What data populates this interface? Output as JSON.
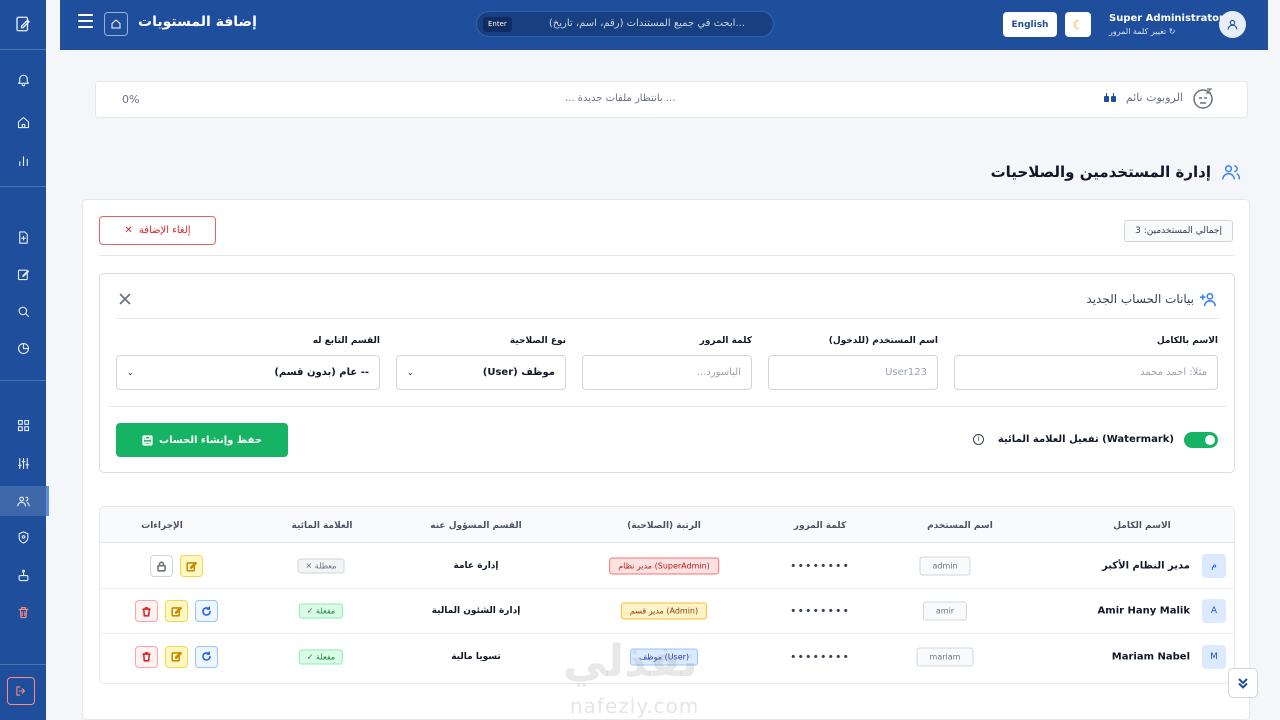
{
  "topbar": {
    "title": "إضافة المستويات",
    "search_placeholder": "ابحث في جميع المستندات (رقم، اسم، تاريخ)...",
    "search_hint": "Enter",
    "language_label": "English",
    "theme_icon": "☾",
    "user_name": "Super Administrator",
    "user_sub": "تغيير كلمة المرور ↻"
  },
  "robot": {
    "label": "الروبوت نائم",
    "status": "... بانتظار ملفات جديدة ...",
    "percent": "0%"
  },
  "section": {
    "title": "إدارة المستخدمين والصلاحيات"
  },
  "toolbar": {
    "cancel_label": "إلغاء الإضافة",
    "cancel_icon": "✕",
    "total_users": "إجمالي المستخدمين: 3"
  },
  "form": {
    "title": "بيانات الحساب الجديد",
    "fullname_label": "الاسم بالكامل",
    "fullname_placeholder": "مثلاً: أحمد محمد",
    "username_label": "اسم المستخدم (للدخول)",
    "username_placeholder": "User123",
    "password_label": "كلمة المرور",
    "password_placeholder": "الباسورد...",
    "role_label": "نوع الصلاحية",
    "role_value": "موظف (User)",
    "dept_label": "القسم التابع له",
    "dept_value": "-- عام (بدون قسم)",
    "chevron": "⌄",
    "watermark_label": "تفعيل العلامة المائية (Watermark)",
    "watermark_info": "i",
    "watermark_enabled": true,
    "save_label": "حفظ وإنشاء الحساب"
  },
  "table": {
    "headers": {
      "fullname": "الاسم الكامل",
      "username": "اسم المستخدم",
      "password": "كلمة المرور",
      "role": "الرتبة (الصلاحية)",
      "dept": "القسم المسؤول عنه",
      "watermark": "العلامة المائية",
      "actions": "الإجراءات"
    },
    "rows": [
      {
        "initial": "م",
        "name": "مدير النظام الأكبر",
        "username": "admin",
        "password": "••••••••",
        "role": "مدير نظام (SuperAdmin)",
        "dept": "إدارة عامة",
        "watermark": "✕ معطلة"
      },
      {
        "initial": "A",
        "name": "Amir Hany Malik",
        "username": "amir",
        "password": "••••••••",
        "role": "مدير قسم (Admin)",
        "dept": "إدارة الشئون المالية",
        "watermark": "✓ مفعلة"
      },
      {
        "initial": "M",
        "name": "Mariam Nabel",
        "username": "mariam",
        "password": "••••••••",
        "role": "موظف (User)",
        "dept": "تسويا مالية",
        "watermark": "✓ مفعلة"
      }
    ]
  },
  "watermark_overlay": {
    "brand_ar": "نفذلي",
    "brand_en": "nafezly.com"
  },
  "colors": {
    "primary": "#1f4e9c",
    "success": "#16b364",
    "danger": "#dc2626"
  }
}
